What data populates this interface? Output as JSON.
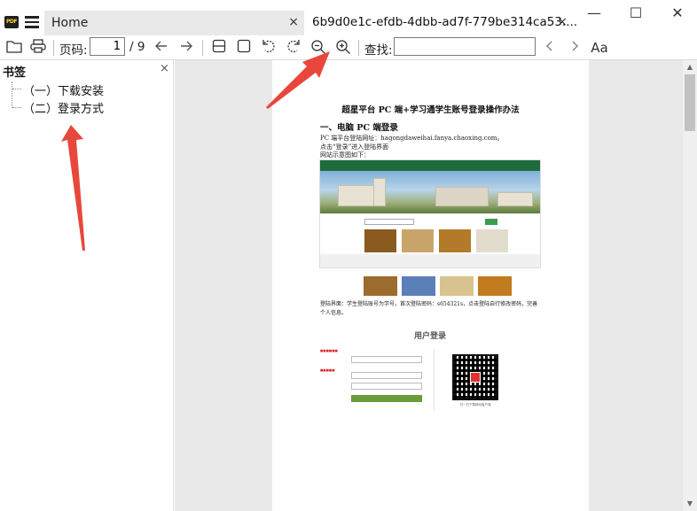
{
  "app": {
    "logo_text": "PDF",
    "tabs": [
      {
        "label": "Home",
        "active": false
      },
      {
        "label": "6b9d0e1c-efdb-4dbb-ad7f-779be314ca53....",
        "active": true
      }
    ],
    "close_glyph": "×",
    "window_controls": {
      "minimize": "—",
      "maximize": "☐",
      "close": "✕"
    }
  },
  "toolbar": {
    "page_label": "页码:",
    "page_value": "1",
    "page_total": "/ 9",
    "find_label": "查找:",
    "find_value": "",
    "icons": [
      "folder-icon",
      "print-icon",
      "arrow-left-icon",
      "arrow-right-icon",
      "fit-width-icon",
      "fit-page-icon",
      "rotate-left-icon",
      "rotate-right-icon",
      "zoom-out-icon",
      "zoom-in-icon",
      "find-prev-icon",
      "find-next-icon",
      "font-icon"
    ],
    "font_btn": "Aa"
  },
  "sidebar": {
    "title": "书签",
    "close": "×",
    "bookmarks": [
      {
        "label": "（一）下载安装"
      },
      {
        "label": "（二）登录方式"
      }
    ]
  },
  "document": {
    "title": "超星平台 PC 端+学习通学生账号登录操作办法",
    "h1": "一、电脑 PC 端登录",
    "lines": [
      "PC 端平台登陆网址：hagongdaweihai.fanya.chaoxing.com。",
      "点击“登录”进入登陆界面",
      "网站示意图如下："
    ],
    "note_1": "登陆界面：学生登陆账号为学号，首次登陆密码：s654321s，点击登陆自行修改密码，完善",
    "note_2": "个人信息。",
    "login_title": "用户登录",
    "qr_caption": "扫一扫下载移动客户端"
  },
  "colors": {
    "accent_arrow": "#e8473b",
    "site_header": "#1e6b3c",
    "login_button": "#6b9b3a"
  }
}
